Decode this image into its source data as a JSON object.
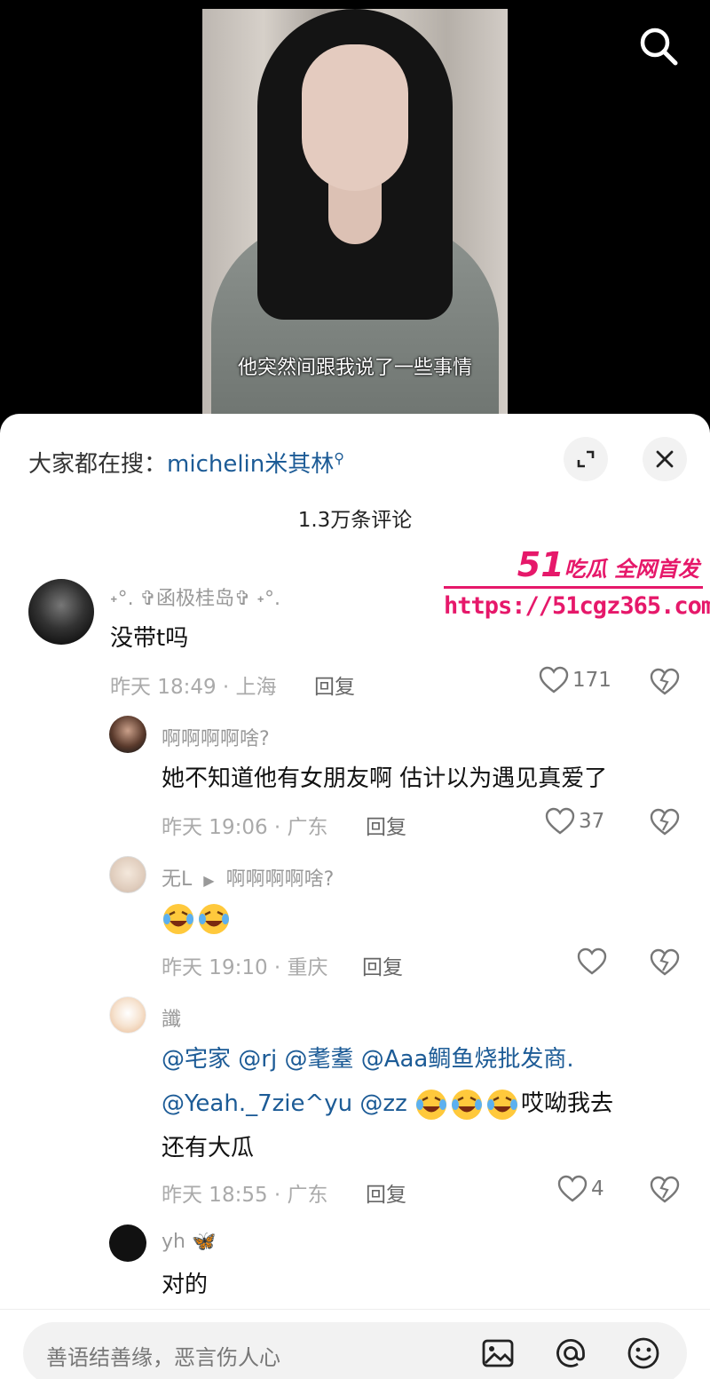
{
  "video": {
    "subtitle": "他突然间跟我说了一些事情"
  },
  "sheet": {
    "hot_search_prefix": "大家都在搜：",
    "hot_search_keyword": "michelin米其林",
    "comment_count": "1.3万条评论"
  },
  "watermark": {
    "brand_num": "51",
    "brand_text": "吃瓜 全网首发",
    "url": "https://51cgz365.com"
  },
  "comments": [
    {
      "name": "˖°. ✞函极桂岛✞ ˖°.",
      "text": "没带t吗",
      "time_loc": "昨天 18:49 · 上海",
      "reply": "回复",
      "likes": "171"
    },
    {
      "name": "啊啊啊啊啥?",
      "text": "她不知道他有女朋友啊 估计以为遇见真爱了",
      "time_loc": "昨天 19:06 · 广东",
      "reply": "回复",
      "likes": "37"
    },
    {
      "name": "无L",
      "reply_to": "啊啊啊啊啥?",
      "time_loc": "昨天 19:10 · 重庆",
      "reply": "回复",
      "likes": ""
    },
    {
      "name": "讖",
      "mentions_line1": "@宅家 @rj @耄耋 @Aaa鲷鱼烧批发商.",
      "mentions_line2": "@Yeah._7zie^yu @zz",
      "text_tail": "哎呦我去",
      "text_line3": "还有大瓜",
      "time_loc": "昨天 18:55 · 广东",
      "reply": "回复",
      "likes": "4"
    },
    {
      "name": "yh",
      "name_emoji": "🦋",
      "text": "对的"
    }
  ],
  "input": {
    "placeholder": "善语结善缘，恶言伤人心"
  },
  "colors": {
    "link": "#1c5b96",
    "watermark": "#e6186a"
  }
}
